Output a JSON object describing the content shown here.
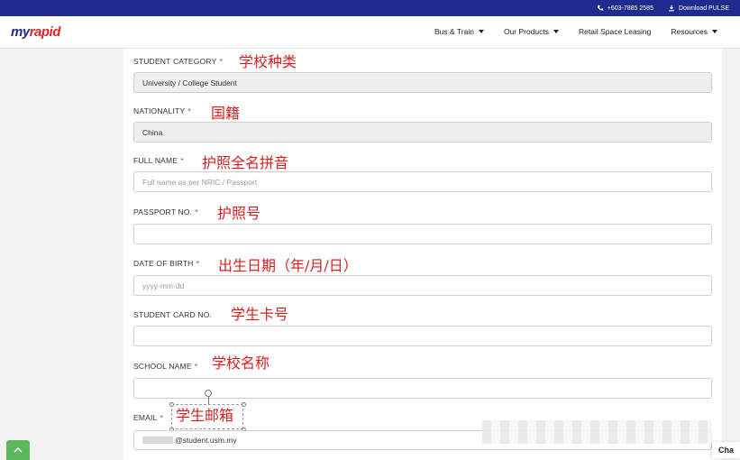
{
  "topbar": {
    "phone": "+603-7885 2585",
    "download": "Download PULSE"
  },
  "brand": {
    "part1": "my",
    "part2": "rapid"
  },
  "nav": {
    "items": [
      {
        "label": "Bus & Train"
      },
      {
        "label": "Our Products"
      },
      {
        "label": "Retail Space Leasing"
      },
      {
        "label": "Resources"
      }
    ]
  },
  "form": {
    "required_mark": "*",
    "student_category": {
      "label": "STUDENT CATEGORY",
      "value": "University / College Student",
      "annotation": "学校种类"
    },
    "nationality": {
      "label": "NATIONALITY",
      "value": "China",
      "annotation": "国籍"
    },
    "full_name": {
      "label": "FULL NAME",
      "placeholder": "Full name as per NRIC / Passport",
      "annotation": "护照全名拼音"
    },
    "passport_no": {
      "label": "PASSPORT NO.",
      "annotation": "护照号"
    },
    "date_of_birth": {
      "label": "DATE OF BIRTH",
      "placeholder": "yyyy-mm-dd",
      "annotation": "出生日期（年/月/日）"
    },
    "student_card_no": {
      "label": "STUDENT CARD NO.",
      "annotation": "学生卡号"
    },
    "school_name": {
      "label": "SCHOOL NAME",
      "annotation": "学校名称"
    },
    "email": {
      "label": "EMAIL",
      "value": "@student.usm.my",
      "annotation": "学生邮箱"
    }
  },
  "chat": {
    "label": "Cha"
  },
  "colors": {
    "topbar": "#1f2b8f",
    "brand_blue": "#1f2b8f",
    "brand_red": "#e0242b",
    "annotation_red": "#d61f1f",
    "green_button": "#5cb85c"
  }
}
